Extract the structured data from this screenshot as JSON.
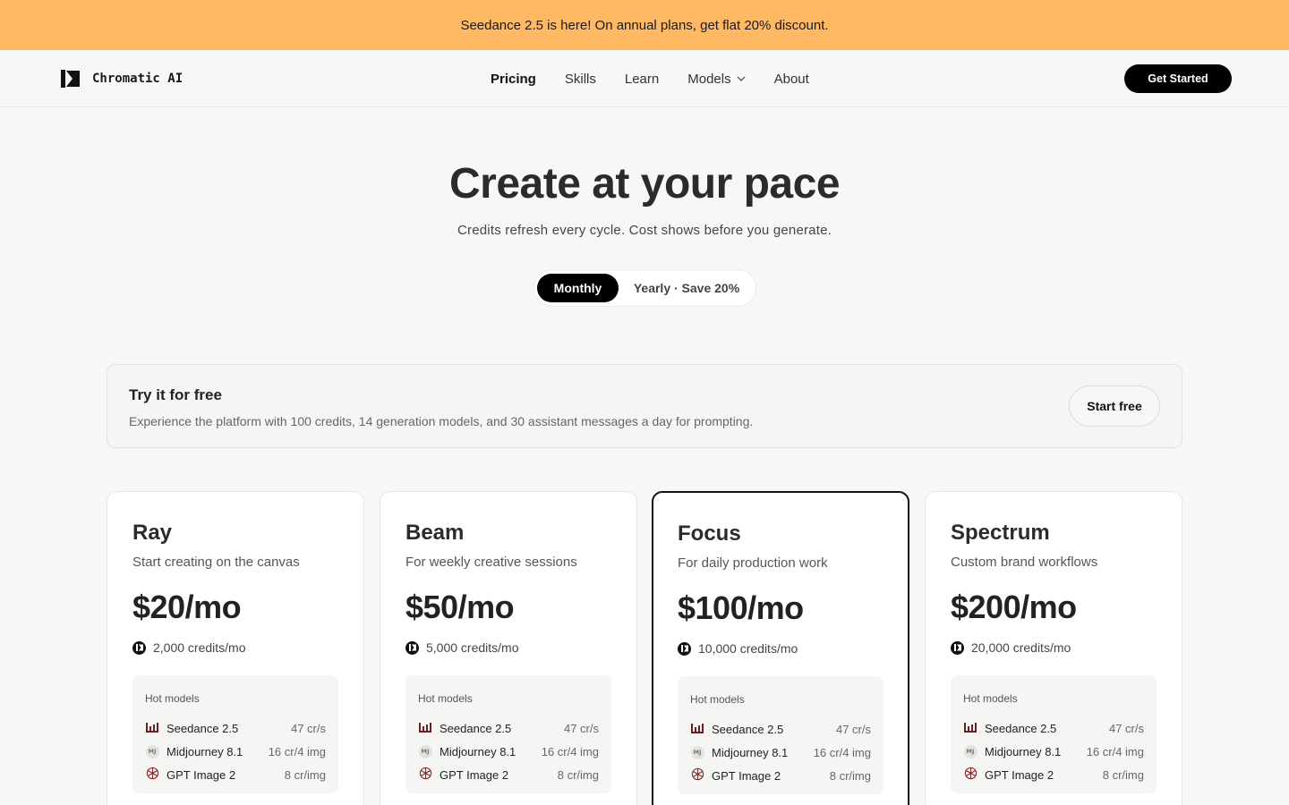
{
  "banner": {
    "text": "Seedance 2.5 is here! On annual plans, get flat 20% discount."
  },
  "brand": {
    "name": "Chromatic AI",
    "logo_icon": "chromatic-logo-icon"
  },
  "nav": {
    "links": [
      "Pricing",
      "Skills",
      "Learn",
      "Models",
      "About"
    ],
    "active": "Pricing",
    "cta_label": "Get Started"
  },
  "hero": {
    "title": "Create at your pace",
    "subtitle": "Credits refresh every cycle. Cost shows before you generate."
  },
  "billing_toggle": {
    "options": [
      "Monthly",
      "Yearly · Save 20%"
    ],
    "selected": "Monthly"
  },
  "free_tier": {
    "title": "Try it for free",
    "description": "Experience the platform with 100 credits, 14 generation models, and 30 assistant messages a day for prompting.",
    "button_label": "Start free"
  },
  "hot_models_label": "Hot models",
  "plans": [
    {
      "name": "Ray",
      "description": "Start creating on the canvas",
      "price": "$20/mo",
      "credits": "2,000 credits/mo",
      "featured": false,
      "models": [
        {
          "name": "Seedance 2.5",
          "cost": "47 cr/s",
          "icon": "seedance-bars-icon"
        },
        {
          "name": "Midjourney 8.1",
          "cost": "16 cr/4 img",
          "icon": "midjourney-badge-icon"
        },
        {
          "name": "GPT Image 2",
          "cost": "8 cr/img",
          "icon": "openai-knot-icon"
        }
      ]
    },
    {
      "name": "Beam",
      "description": "For weekly creative sessions",
      "price": "$50/mo",
      "credits": "5,000 credits/mo",
      "featured": false,
      "models": [
        {
          "name": "Seedance 2.5",
          "cost": "47 cr/s",
          "icon": "seedance-bars-icon"
        },
        {
          "name": "Midjourney 8.1",
          "cost": "16 cr/4 img",
          "icon": "midjourney-badge-icon"
        },
        {
          "name": "GPT Image 2",
          "cost": "8 cr/img",
          "icon": "openai-knot-icon"
        }
      ]
    },
    {
      "name": "Focus",
      "description": "For daily production work",
      "price": "$100/mo",
      "credits": "10,000 credits/mo",
      "featured": true,
      "models": [
        {
          "name": "Seedance 2.5",
          "cost": "47 cr/s",
          "icon": "seedance-bars-icon"
        },
        {
          "name": "Midjourney 8.1",
          "cost": "16 cr/4 img",
          "icon": "midjourney-badge-icon"
        },
        {
          "name": "GPT Image 2",
          "cost": "8 cr/img",
          "icon": "openai-knot-icon"
        }
      ]
    },
    {
      "name": "Spectrum",
      "description": "Custom brand workflows",
      "price": "$200/mo",
      "credits": "20,000 credits/mo",
      "featured": false,
      "models": [
        {
          "name": "Seedance 2.5",
          "cost": "47 cr/s",
          "icon": "seedance-bars-icon"
        },
        {
          "name": "Midjourney 8.1",
          "cost": "16 cr/4 img",
          "icon": "midjourney-badge-icon"
        },
        {
          "name": "GPT Image 2",
          "cost": "8 cr/img",
          "icon": "openai-knot-icon"
        }
      ]
    }
  ],
  "mj_badge_text": "MJ",
  "colors": {
    "banner": "#ffb964",
    "accent": "#000000",
    "seedance_icon": "#6b1f1f",
    "openai_icon": "#8a2a2a"
  }
}
